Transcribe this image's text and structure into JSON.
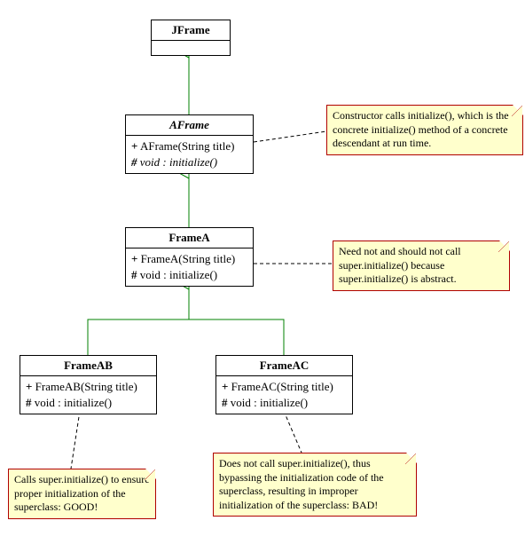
{
  "classes": {
    "jframe": {
      "name": "JFrame"
    },
    "aframe": {
      "name": "AFrame",
      "line1_sym": "+",
      "line1_text": "AFrame(String title)",
      "line2_sym": "#",
      "line2_text": "void : initialize()"
    },
    "framea": {
      "name": "FrameA",
      "line1_sym": "+",
      "line1_text": "FrameA(String title)",
      "line2_sym": "#",
      "line2_text": "void : initialize()"
    },
    "frameab": {
      "name": "FrameAB",
      "line1_sym": "+",
      "line1_text": "FrameAB(String title)",
      "line2_sym": "#",
      "line2_text": "void : initialize()"
    },
    "frameac": {
      "name": "FrameAC",
      "line1_sym": "+",
      "line1_text": "FrameAC(String title)",
      "line2_sym": "#",
      "line2_text": "void : initialize()"
    }
  },
  "notes": {
    "n1": "Constructor calls initialize(), which is the concrete initialize() method of a concrete descendant at run time.",
    "n2": "Need not and should not call super.initialize() because super.initialize() is abstract.",
    "n3": "Calls super.initialize() to ensure proper initialization of the superclass: GOOD!",
    "n4": "Does not call super.initialize(), thus bypassing the initialization code of the superclass, resulting in improper initialization of the superclass: BAD!"
  },
  "relations": [
    {
      "type": "generalization",
      "from": "AFrame",
      "to": "JFrame"
    },
    {
      "type": "generalization",
      "from": "FrameA",
      "to": "AFrame"
    },
    {
      "type": "generalization",
      "from": "FrameAB",
      "to": "FrameA"
    },
    {
      "type": "generalization",
      "from": "FrameAC",
      "to": "FrameA"
    },
    {
      "type": "note-anchor",
      "from": "note1",
      "to": "AFrame"
    },
    {
      "type": "note-anchor",
      "from": "note2",
      "to": "FrameA"
    },
    {
      "type": "note-anchor",
      "from": "note3",
      "to": "FrameAB"
    },
    {
      "type": "note-anchor",
      "from": "note4",
      "to": "FrameAC"
    }
  ]
}
